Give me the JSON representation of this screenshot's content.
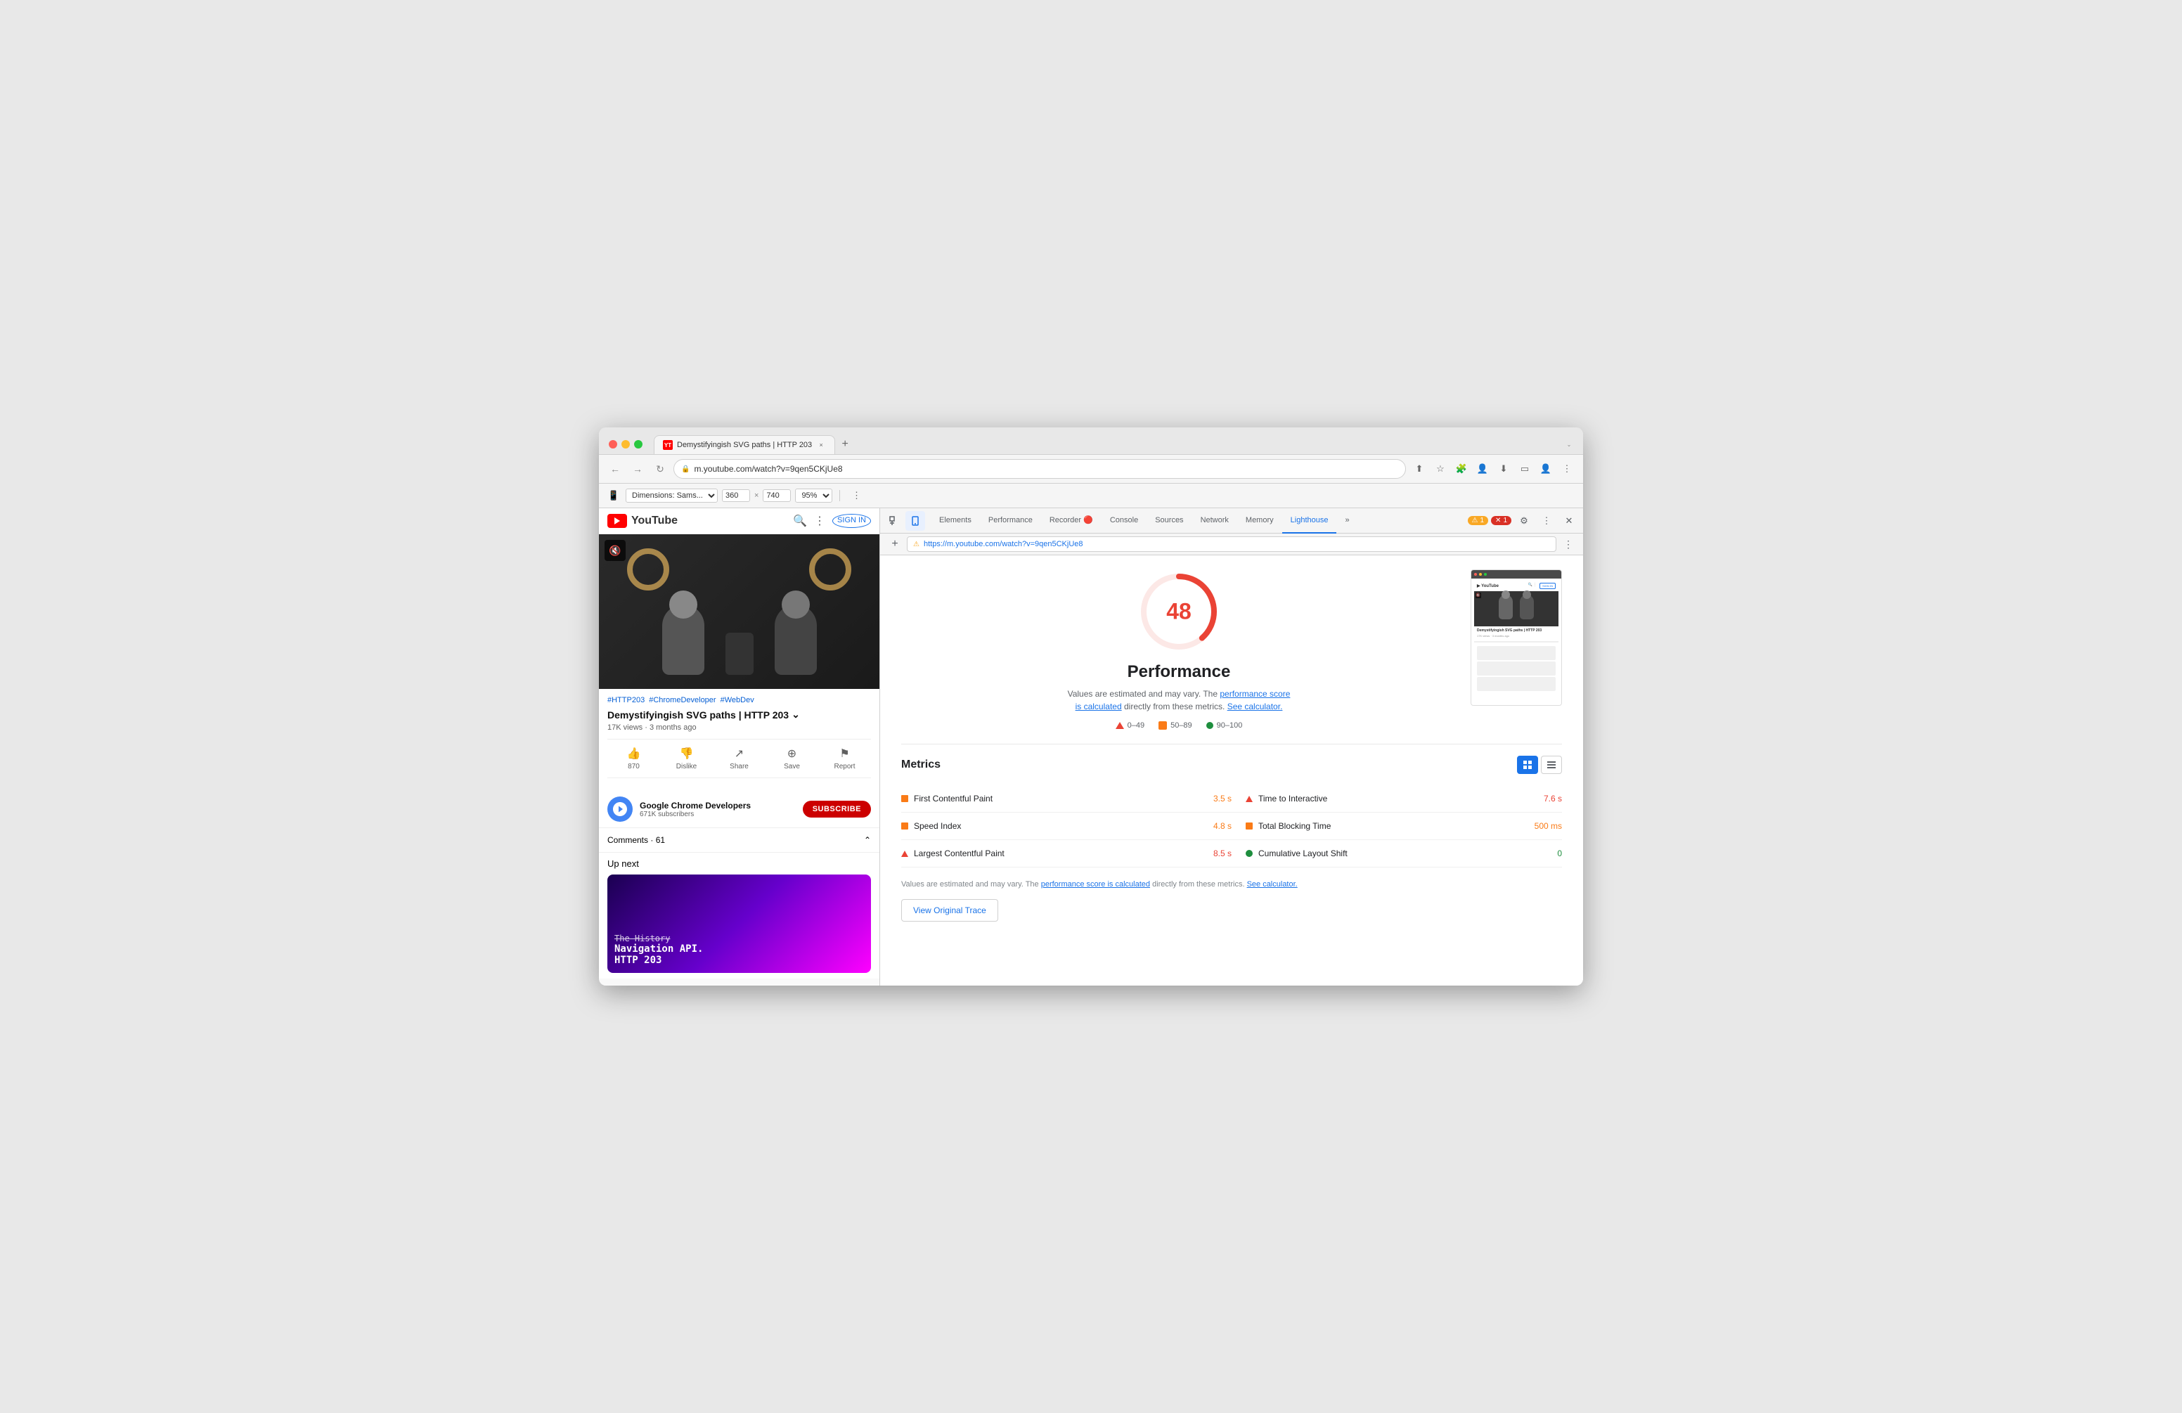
{
  "browser": {
    "title": "Demystifyingish SVG paths | HTTP 203",
    "tab_favicon": "YT",
    "tab_close": "×",
    "url": "m.youtube.com/watch?v=9qen5CKjUe8",
    "url_full": "https://m.youtube.com/watch?v=9qen5CKjUe8",
    "dimensions_label": "Dimensions: Sams...",
    "width_val": "360",
    "x_sep": "×",
    "height_val": "740",
    "zoom_val": "95%",
    "plus_btn": "+"
  },
  "devtools": {
    "tabs": [
      {
        "label": "Elements",
        "active": false
      },
      {
        "label": "Performance",
        "active": false
      },
      {
        "label": "Recorder 🔴",
        "active": false
      },
      {
        "label": "Console",
        "active": false
      },
      {
        "label": "Sources",
        "active": false
      },
      {
        "label": "Network",
        "active": false
      },
      {
        "label": "Memory",
        "active": false
      },
      {
        "label": "Lighthouse",
        "active": true
      }
    ],
    "warn_count": "1",
    "error_count": "1",
    "lh_url": "https://m.youtube.com/watch?v=9qen5CKjUe8"
  },
  "lighthouse": {
    "score": "48",
    "performance_label": "Performance",
    "desc1": "Values are estimated and may vary. The ",
    "desc_link1": "performance score is calculated",
    "desc2": " directly from these metrics. ",
    "desc_link2": "See calculator.",
    "legend": [
      {
        "range": "0–49",
        "color_type": "red_tri"
      },
      {
        "range": "50–89",
        "color_type": "orange_sq"
      },
      {
        "range": "90–100",
        "color_type": "green_circle"
      }
    ],
    "metrics_title": "Metrics",
    "metrics": [
      {
        "name": "First Contentful Paint",
        "value": "3.5 s",
        "color": "orange",
        "indicator": "orange_sq",
        "col": 0
      },
      {
        "name": "Time to Interactive",
        "value": "7.6 s",
        "color": "red",
        "indicator": "red_tri",
        "col": 1
      },
      {
        "name": "Speed Index",
        "value": "4.8 s",
        "color": "orange",
        "indicator": "orange_sq",
        "col": 0
      },
      {
        "name": "Total Blocking Time",
        "value": "500 ms",
        "color": "orange",
        "indicator": "orange_sq",
        "col": 1
      },
      {
        "name": "Largest Contentful Paint",
        "value": "8.5 s",
        "color": "red",
        "indicator": "red_tri",
        "col": 0
      },
      {
        "name": "Cumulative Layout Shift",
        "value": "0",
        "color": "green",
        "indicator": "green_circle",
        "col": 1
      }
    ],
    "bottom_note1": "Values are estimated and may vary. The ",
    "bottom_note_link1": "performance score is calculated",
    "bottom_note2": " directly from these metrics. ",
    "bottom_note_link2": "See calculator.",
    "view_trace_btn": "View Original Trace"
  },
  "youtube": {
    "logo_text": "YouTube",
    "tags": [
      "#HTTP203",
      "#ChromeDeveloper",
      "#WebDev"
    ],
    "video_title": "Demystifyingish SVG paths | HTTP 203",
    "view_count": "17K views",
    "upload_time": "3 months ago",
    "like_count": "870",
    "actions": [
      {
        "label": "870",
        "icon": "👍"
      },
      {
        "label": "Dislike",
        "icon": "👎"
      },
      {
        "label": "Share",
        "icon": "↗"
      },
      {
        "label": "Save",
        "icon": "⊕"
      },
      {
        "label": "Report",
        "icon": "⚑"
      }
    ],
    "channel_name": "Google Chrome Developers",
    "channel_subs": "671K subscribers",
    "subscribe_btn": "SUBSCRIBE",
    "comments_label": "Comments",
    "comments_count": "61",
    "up_next_label": "Up next",
    "up_next_title_strikethrough": "The History",
    "up_next_title": "Navigation API.",
    "up_next_subtitle": "HTTP 203"
  }
}
